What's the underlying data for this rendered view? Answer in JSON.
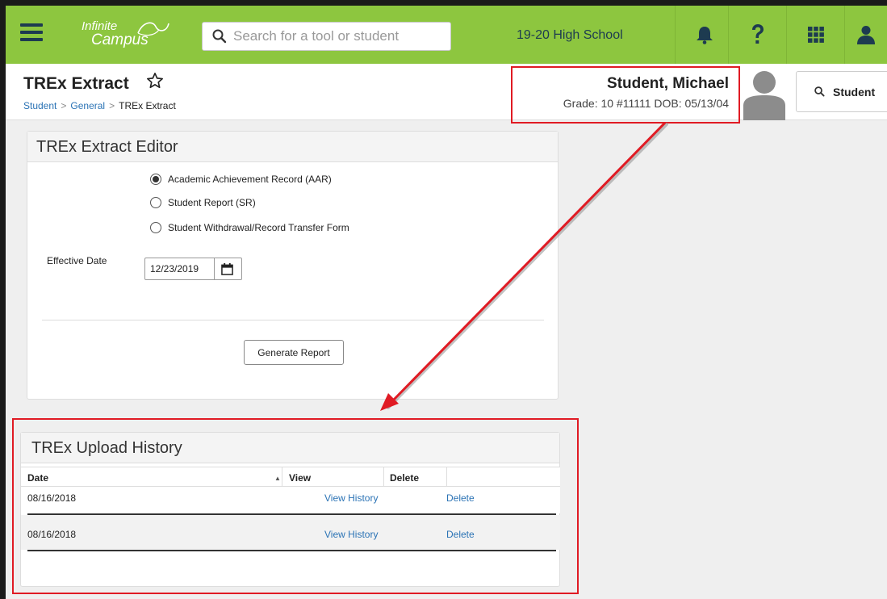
{
  "app": {
    "logo_line1": "Infinite",
    "logo_line2": "Campus",
    "search_placeholder": "Search for a tool or student",
    "school": "19-20 High School",
    "icons": [
      "bell-icon",
      "help-icon",
      "apps-grid-icon",
      "user-icon"
    ]
  },
  "header": {
    "title": "TREx Extract",
    "breadcrumb": [
      "Student",
      "General",
      "TREx Extract"
    ],
    "student_name": "Student, Michael",
    "student_meta": "Grade: 10 #11111 DOB: 05/13/04",
    "student_button": "Student"
  },
  "editor": {
    "title": "TREx Extract Editor",
    "options": [
      {
        "label": "Academic Achievement Record (AAR)",
        "checked": true
      },
      {
        "label": "Student Report (SR)",
        "checked": false
      },
      {
        "label": "Student Withdrawal/Record Transfer Form",
        "checked": false
      }
    ],
    "effective_date_label": "Effective Date",
    "effective_date_value": "12/23/2019",
    "generate_button": "Generate Report"
  },
  "history": {
    "title": "TREx Upload History",
    "columns": [
      "Date",
      "View",
      "Delete"
    ],
    "sort_indicator": "▲",
    "rows": [
      {
        "date": "08/16/2018",
        "view": "View History",
        "delete": "Delete"
      },
      {
        "date": "08/16/2018",
        "view": "View History",
        "delete": "Delete"
      }
    ]
  },
  "colors": {
    "topbar": "#8dc63f",
    "link": "#2b73b5",
    "annotation": "#e01b24"
  }
}
